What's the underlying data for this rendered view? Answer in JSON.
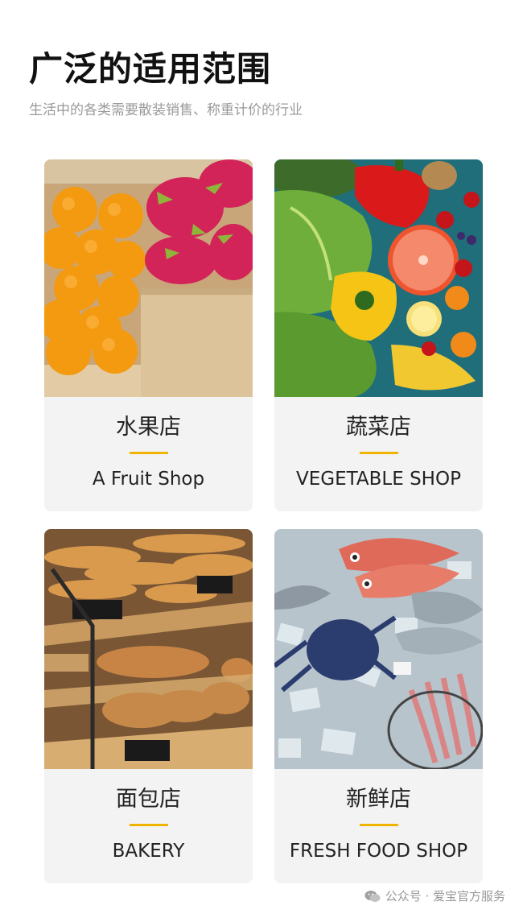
{
  "header": {
    "title": "广泛的适用范围",
    "subtitle": "生活中的各类需要散装销售、称重计价的行业"
  },
  "cards": [
    {
      "zh": "水果店",
      "en": "A Fruit Shop",
      "image": "fruit-photo"
    },
    {
      "zh": "蔬菜店",
      "en": "VEGETABLE SHOP",
      "image": "vegetable-photo"
    },
    {
      "zh": "面包店",
      "en": "BAKERY",
      "image": "bakery-photo"
    },
    {
      "zh": "新鲜店",
      "en": "FRESH FOOD SHOP",
      "image": "seafood-photo"
    }
  ],
  "footer": {
    "text": "公众号 · 爱宝官方服务",
    "icon": "wechat-icon"
  },
  "colors": {
    "accent": "#f0b400",
    "card_bg": "#f3f3f3",
    "title": "#111111",
    "subtitle": "#9a9a9a"
  }
}
